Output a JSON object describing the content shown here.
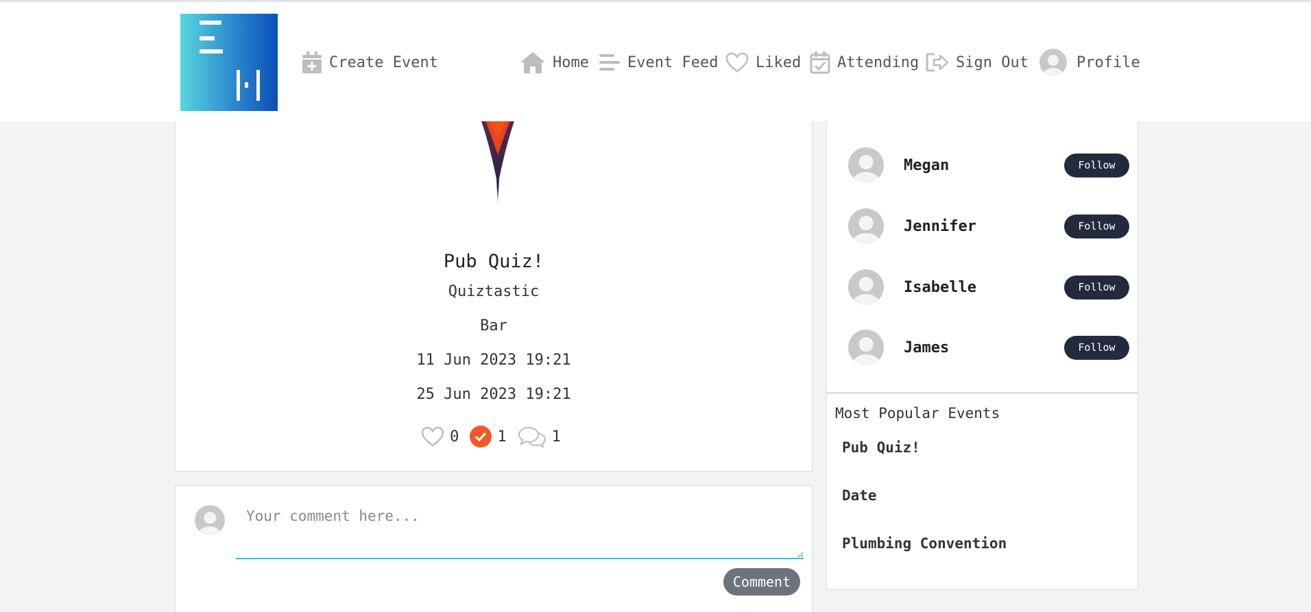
{
  "nav": {
    "logo": "logo",
    "create_event": "Create Event",
    "home": "Home",
    "event_feed": "Event Feed",
    "liked": "Liked",
    "attending": "Attending",
    "sign_out": "Sign Out",
    "profile": "Profile"
  },
  "event": {
    "title": "Pub Quiz!",
    "organizer": "Quiztastic",
    "venue": "Bar",
    "start": "11 Jun 2023 19:21",
    "end": "25 Jun 2023 19:21",
    "likes": "0",
    "attending": "1",
    "comments": "1"
  },
  "comment": {
    "placeholder": "Your comment here...",
    "button": "Comment"
  },
  "people": [
    {
      "name": "Megan",
      "action": "Follow"
    },
    {
      "name": "Jennifer",
      "action": "Follow"
    },
    {
      "name": "Isabelle",
      "action": "Follow"
    },
    {
      "name": "James",
      "action": "Follow"
    }
  ],
  "popular": {
    "title": "Most Popular Events",
    "items": [
      "Pub Quiz!",
      "Date",
      "Plumbing Convention"
    ]
  },
  "colors": {
    "accent": "#f05a28",
    "button_dark": "#232a3d",
    "input_underline": "#2cc4d8",
    "comment_button": "#6e727d"
  },
  "icons": [
    "calendar-plus-icon",
    "home-icon",
    "feed-icon",
    "heart-icon",
    "calendar-check-icon",
    "sign-out-icon",
    "profile-avatar-icon",
    "check-icon",
    "comments-icon"
  ]
}
